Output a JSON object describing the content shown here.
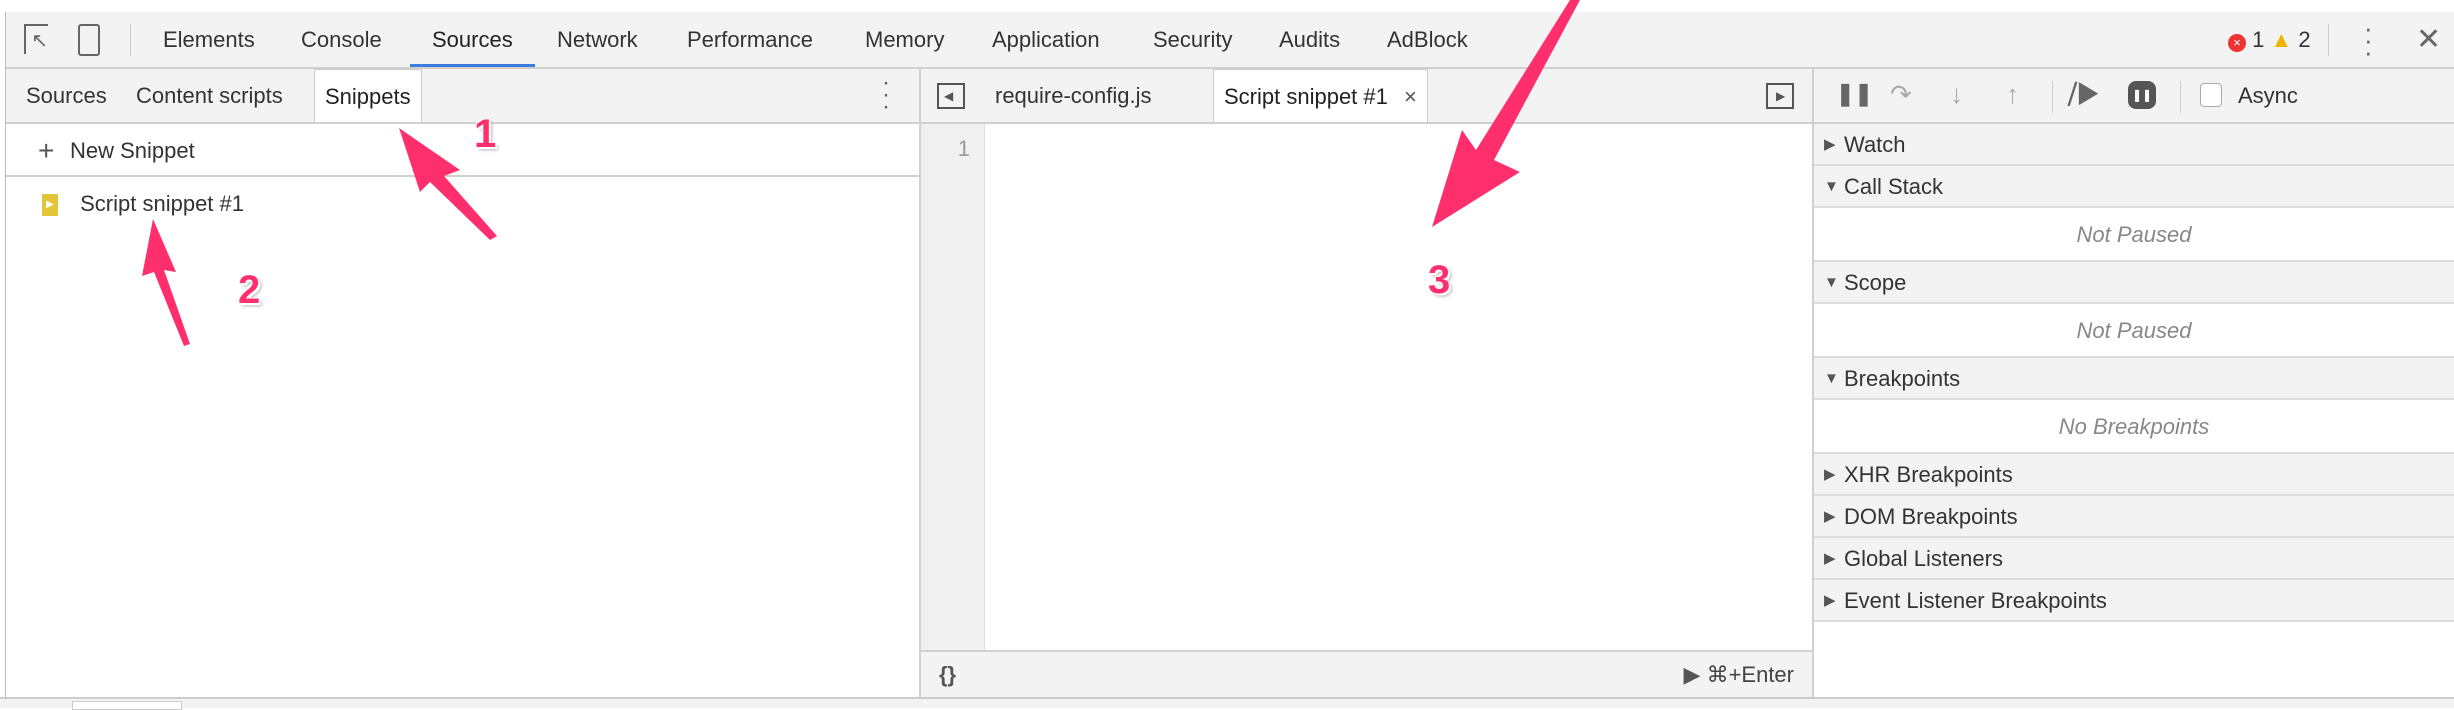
{
  "main_tabs": [
    "Elements",
    "Console",
    "Sources",
    "Network",
    "Performance",
    "Memory",
    "Application",
    "Security",
    "Audits",
    "AdBlock"
  ],
  "active_tab": "Sources",
  "status": {
    "errors": "1",
    "warnings": "2"
  },
  "navigator_tabs": [
    "Sources",
    "Content scripts",
    "Snippets"
  ],
  "new_snippet": "New Snippet",
  "snippet_item": "Script snippet #1",
  "editor_tabs": [
    "require-config.js",
    "Script snippet #1"
  ],
  "line_number": "1",
  "footer": {
    "format": "{}",
    "run": "⌘+Enter"
  },
  "debugger": {
    "async": "Async",
    "async_checked": false
  },
  "sections": {
    "watch": "Watch",
    "call_stack": "Call Stack",
    "not_paused_1": "Not Paused",
    "scope": "Scope",
    "not_paused_2": "Not Paused",
    "breakpoints": "Breakpoints",
    "no_breakpoints": "No Breakpoints",
    "xhr": "XHR Breakpoints",
    "dom": "DOM Breakpoints",
    "global": "Global Listeners",
    "event": "Event Listener Breakpoints"
  },
  "annotations": [
    "1",
    "2",
    "3"
  ],
  "colors": {
    "accent": "#3b7ddd",
    "annotation": "#ff2f6d",
    "snippet_icon": "#e3c53a"
  }
}
